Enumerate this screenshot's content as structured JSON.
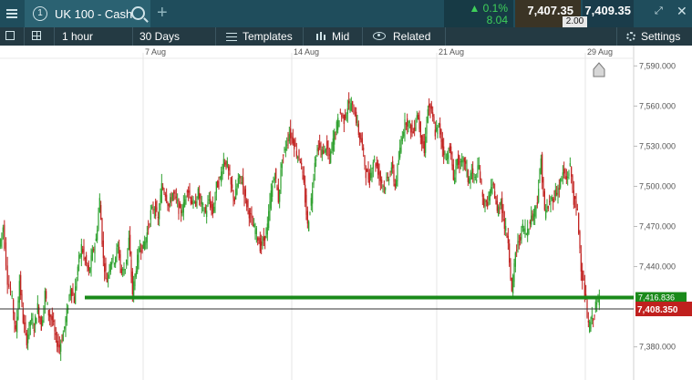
{
  "topbar": {
    "tab_number": "1",
    "instrument": "UK 100 - Cash",
    "change_pct": "▲ 0.1%",
    "change_pts": "8.04",
    "sell_price": "7,407.35",
    "spread": "2.00",
    "buy_price": "7,409.35",
    "colors": {
      "up": "#3fd05a",
      "bar": "#1f4d5c"
    }
  },
  "toolbar": {
    "interval": "1 hour",
    "range": "30 Days",
    "templates": "Templates",
    "price_type": "Mid",
    "related": "Related",
    "settings": "Settings"
  },
  "chart_data": {
    "type": "candlestick",
    "x_labels": [
      "7 Aug",
      "14 Aug",
      "21 Aug",
      "29 Aug"
    ],
    "y_ticks": [
      "7,590.000",
      "7,560.000",
      "7,530.000",
      "7,500.000",
      "7,470.000",
      "7,440.000",
      "7,380.000"
    ],
    "y_tick_values": [
      7590,
      7560,
      7530,
      7500,
      7470,
      7440,
      7380
    ],
    "ylim": [
      7360,
      7595
    ],
    "horizontal_line": {
      "label": "7,416.836",
      "value": 7416.836,
      "color": "#1a8a1a"
    },
    "current_price": {
      "label": "7,408.350",
      "value": 7408.35,
      "color": "#c0201e"
    },
    "series_path": [
      [
        0,
        7455
      ],
      [
        4,
        7470
      ],
      [
        9,
        7430
      ],
      [
        14,
        7415
      ],
      [
        18,
        7390
      ],
      [
        22,
        7430
      ],
      [
        26,
        7400
      ],
      [
        30,
        7385
      ],
      [
        34,
        7400
      ],
      [
        38,
        7395
      ],
      [
        42,
        7410
      ],
      [
        46,
        7395
      ],
      [
        50,
        7420
      ],
      [
        54,
        7405
      ],
      [
        58,
        7400
      ],
      [
        62,
        7385
      ],
      [
        66,
        7380
      ],
      [
        70,
        7390
      ],
      [
        74,
        7405
      ],
      [
        78,
        7425
      ],
      [
        82,
        7415
      ],
      [
        86,
        7440
      ],
      [
        90,
        7455
      ],
      [
        94,
        7445
      ],
      [
        98,
        7435
      ],
      [
        102,
        7450
      ],
      [
        106,
        7460
      ],
      [
        110,
        7490
      ],
      [
        114,
        7445
      ],
      [
        118,
        7430
      ],
      [
        122,
        7445
      ],
      [
        126,
        7445
      ],
      [
        130,
        7455
      ],
      [
        134,
        7435
      ],
      [
        138,
        7440
      ],
      [
        142,
        7460
      ],
      [
        146,
        7420
      ],
      [
        150,
        7440
      ],
      [
        154,
        7455
      ],
      [
        158,
        7455
      ],
      [
        162,
        7465
      ],
      [
        166,
        7480
      ],
      [
        170,
        7485
      ],
      [
        174,
        7475
      ],
      [
        178,
        7500
      ],
      [
        182,
        7495
      ],
      [
        186,
        7485
      ],
      [
        190,
        7495
      ],
      [
        194,
        7490
      ],
      [
        198,
        7480
      ],
      [
        202,
        7485
      ],
      [
        206,
        7500
      ],
      [
        210,
        7490
      ],
      [
        214,
        7485
      ],
      [
        218,
        7495
      ],
      [
        222,
        7485
      ],
      [
        226,
        7480
      ],
      [
        230,
        7490
      ],
      [
        234,
        7480
      ],
      [
        238,
        7500
      ],
      [
        242,
        7505
      ],
      [
        246,
        7520
      ],
      [
        250,
        7515
      ],
      [
        254,
        7500
      ],
      [
        258,
        7490
      ],
      [
        262,
        7505
      ],
      [
        266,
        7505
      ],
      [
        270,
        7490
      ],
      [
        274,
        7480
      ],
      [
        278,
        7470
      ],
      [
        282,
        7465
      ],
      [
        286,
        7455
      ],
      [
        290,
        7460
      ],
      [
        294,
        7470
      ],
      [
        298,
        7495
      ],
      [
        302,
        7510
      ],
      [
        306,
        7490
      ],
      [
        310,
        7520
      ],
      [
        314,
        7530
      ],
      [
        318,
        7540
      ],
      [
        322,
        7535
      ],
      [
        326,
        7525
      ],
      [
        330,
        7520
      ],
      [
        334,
        7500
      ],
      [
        338,
        7470
      ],
      [
        342,
        7490
      ],
      [
        346,
        7520
      ],
      [
        350,
        7530
      ],
      [
        354,
        7525
      ],
      [
        358,
        7530
      ],
      [
        362,
        7520
      ],
      [
        366,
        7535
      ],
      [
        370,
        7545
      ],
      [
        374,
        7555
      ],
      [
        378,
        7550
      ],
      [
        382,
        7560
      ],
      [
        386,
        7560
      ],
      [
        390,
        7555
      ],
      [
        394,
        7540
      ],
      [
        398,
        7530
      ],
      [
        402,
        7510
      ],
      [
        406,
        7505
      ],
      [
        410,
        7520
      ],
      [
        414,
        7515
      ],
      [
        418,
        7505
      ],
      [
        422,
        7500
      ],
      [
        426,
        7505
      ],
      [
        430,
        7515
      ],
      [
        434,
        7500
      ],
      [
        438,
        7520
      ],
      [
        442,
        7540
      ],
      [
        446,
        7550
      ],
      [
        450,
        7545
      ],
      [
        454,
        7540
      ],
      [
        458,
        7555
      ],
      [
        462,
        7540
      ],
      [
        466,
        7525
      ],
      [
        470,
        7560
      ],
      [
        474,
        7555
      ],
      [
        478,
        7540
      ],
      [
        482,
        7545
      ],
      [
        486,
        7530
      ],
      [
        490,
        7520
      ],
      [
        494,
        7530
      ],
      [
        498,
        7505
      ],
      [
        502,
        7520
      ],
      [
        506,
        7515
      ],
      [
        510,
        7520
      ],
      [
        514,
        7505
      ],
      [
        518,
        7510
      ],
      [
        522,
        7505
      ],
      [
        526,
        7515
      ],
      [
        530,
        7490
      ],
      [
        534,
        7485
      ],
      [
        538,
        7495
      ],
      [
        542,
        7500
      ],
      [
        546,
        7480
      ],
      [
        550,
        7490
      ],
      [
        554,
        7470
      ],
      [
        558,
        7460
      ],
      [
        562,
        7420
      ],
      [
        566,
        7450
      ],
      [
        570,
        7460
      ],
      [
        574,
        7470
      ],
      [
        578,
        7465
      ],
      [
        582,
        7475
      ],
      [
        586,
        7480
      ],
      [
        590,
        7490
      ],
      [
        594,
        7520
      ],
      [
        598,
        7480
      ],
      [
        602,
        7485
      ],
      [
        606,
        7490
      ],
      [
        610,
        7495
      ],
      [
        614,
        7500
      ],
      [
        618,
        7510
      ],
      [
        622,
        7505
      ],
      [
        626,
        7515
      ],
      [
        630,
        7490
      ],
      [
        634,
        7480
      ],
      [
        638,
        7440
      ],
      [
        642,
        7420
      ],
      [
        646,
        7395
      ],
      [
        650,
        7400
      ],
      [
        654,
        7410
      ],
      [
        658,
        7415
      ]
    ]
  }
}
